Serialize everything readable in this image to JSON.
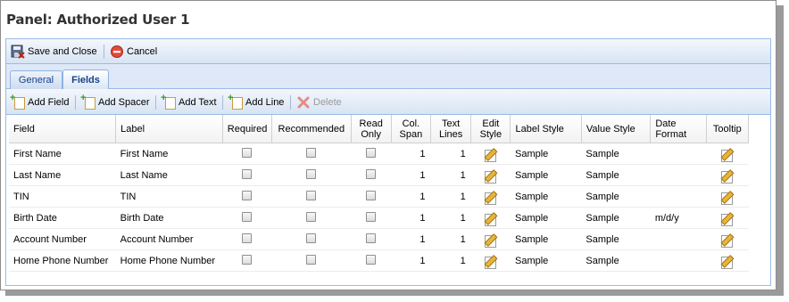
{
  "panel": {
    "title": "Panel: Authorized User 1"
  },
  "toolbar": {
    "save_close_label": "Save and Close",
    "cancel_label": "Cancel"
  },
  "tabs": [
    {
      "label": "General"
    },
    {
      "label": "Fields"
    }
  ],
  "fields_toolbar": {
    "add_field": "Add Field",
    "add_spacer": "Add Spacer",
    "add_text": "Add Text",
    "add_line": "Add Line",
    "delete": "Delete"
  },
  "columns": {
    "field": "Field",
    "label": "Label",
    "required": "Required",
    "recommended": "Recommended",
    "read_only": "Read Only",
    "col_span": "Col. Span",
    "text_lines": "Text Lines",
    "edit_style": "Edit Style",
    "label_style": "Label Style",
    "value_style": "Value Style",
    "date_format": "Date Format",
    "tooltip": "Tooltip"
  },
  "rows": [
    {
      "field": "First Name",
      "label": "First Name",
      "col_span": "1",
      "text_lines": "1",
      "label_style": "Sample",
      "value_style": "Sample",
      "date_format": ""
    },
    {
      "field": "Last Name",
      "label": "Last Name",
      "col_span": "1",
      "text_lines": "1",
      "label_style": "Sample",
      "value_style": "Sample",
      "date_format": ""
    },
    {
      "field": "TIN",
      "label": "TIN",
      "col_span": "1",
      "text_lines": "1",
      "label_style": "Sample",
      "value_style": "Sample",
      "date_format": ""
    },
    {
      "field": "Birth Date",
      "label": "Birth Date",
      "col_span": "1",
      "text_lines": "1",
      "label_style": "Sample",
      "value_style": "Sample",
      "date_format": "m/d/y"
    },
    {
      "field": "Account Number",
      "label": "Account Number",
      "col_span": "1",
      "text_lines": "1",
      "label_style": "Sample",
      "value_style": "Sample",
      "date_format": ""
    },
    {
      "field": "Home Phone Number",
      "label": "Home Phone Number",
      "col_span": "1",
      "text_lines": "1",
      "label_style": "Sample",
      "value_style": "Sample",
      "date_format": ""
    }
  ],
  "colors": {
    "accent": "#15428b",
    "border": "#99bbe8",
    "toolbar_bg": "#dfe8f6"
  }
}
